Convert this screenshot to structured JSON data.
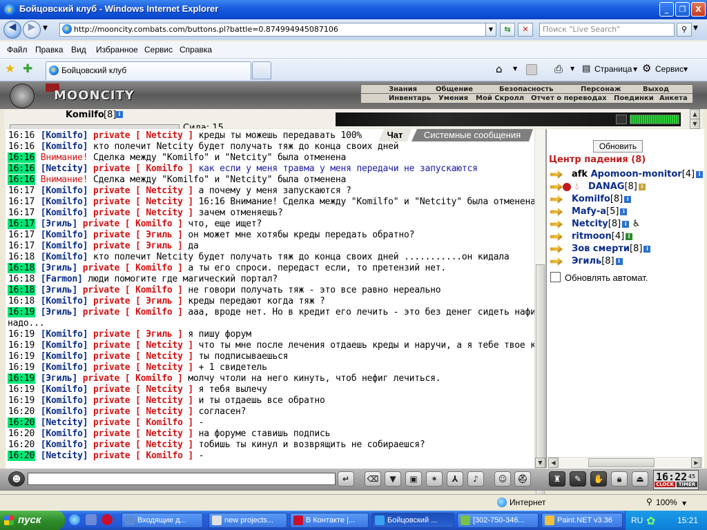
{
  "window": {
    "title": "Бойцовский клуб - Windows Internet Explorer",
    "min": "_",
    "max": "❐",
    "close": "X"
  },
  "address": {
    "url": "http://mooncity.combats.com/buttons.pl?battle=0.874994945087106",
    "search_placeholder": "Поиск \"Live Search\""
  },
  "menu": [
    "Файл",
    "Правка",
    "Вид",
    "Избранное",
    "Сервис",
    "Справка"
  ],
  "tab": {
    "label": "Бойцовский клуб"
  },
  "ie_toolbar": {
    "page": "Страница",
    "service": "Сервис"
  },
  "game": {
    "logo": "MOONCITY",
    "nav_top": [
      "Знания",
      "Общение",
      "Безопасность",
      "Персонаж",
      "Выход"
    ],
    "nav_bottom": [
      "Инвентарь",
      "Умения",
      "Мой Скролл",
      "Отчет о переводах",
      "Поединки",
      "Анкета"
    ],
    "player": {
      "name": "Komilfo",
      "level": "[8]",
      "stat": "Сила: 15"
    }
  },
  "chat": {
    "tabs": [
      "Чат",
      "Системные сообщения"
    ],
    "lines": [
      {
        "t": "16:16",
        "hl": false,
        "parts": [
          {
            "c": "nick",
            "s": "[Komilfo]"
          },
          {
            "c": "priv",
            "s": " private [ Netcity ]"
          },
          {
            "c": "",
            "s": " креды ты можешь передавать 100%"
          }
        ]
      },
      {
        "t": "16:16",
        "hl": false,
        "parts": [
          {
            "c": "nick",
            "s": "[Komilfo]"
          },
          {
            "c": "",
            "s": " кто полечит Netcity будет получать тяж до конца своих дней"
          }
        ]
      },
      {
        "t": "16:16",
        "hl": true,
        "parts": [
          {
            "c": "warn",
            "s": "Внимание!"
          },
          {
            "c": "",
            "s": " Сделка между \"Komilfo\" и \"Netcity\" была отменена"
          }
        ]
      },
      {
        "t": "16:16",
        "hl": true,
        "parts": [
          {
            "c": "nick",
            "s": "[Netcity]"
          },
          {
            "c": "priv",
            "s": " private [ Komilfo ]"
          },
          {
            "c": "blue",
            "s": " как если у меня травма у меня передачи не запускаются"
          }
        ]
      },
      {
        "t": "16:16",
        "hl": true,
        "parts": [
          {
            "c": "warn",
            "s": "Внимание!"
          },
          {
            "c": "",
            "s": " Сделка между \"Komilfo\" и \"Netcity\" была отменена"
          }
        ]
      },
      {
        "t": "16:17",
        "hl": false,
        "parts": [
          {
            "c": "nick",
            "s": "[Komilfo]"
          },
          {
            "c": "priv",
            "s": " private [ Netcity ]"
          },
          {
            "c": "",
            "s": " а почему у меня запускаются ?"
          }
        ]
      },
      {
        "t": "16:17",
        "hl": false,
        "parts": [
          {
            "c": "nick",
            "s": "[Komilfo]"
          },
          {
            "c": "priv",
            "s": " private [ Netcity ]"
          },
          {
            "c": "",
            "s": " 16:16 Внимание! Сделка между \"Komilfo\" и \"Netcity\" была отменена"
          }
        ]
      },
      {
        "t": "16:17",
        "hl": false,
        "parts": [
          {
            "c": "nick",
            "s": "[Komilfo]"
          },
          {
            "c": "priv",
            "s": " private [ Netcity ]"
          },
          {
            "c": "",
            "s": " зачем отменяешь?"
          }
        ]
      },
      {
        "t": "16:17",
        "hl": true,
        "parts": [
          {
            "c": "nick",
            "s": "[Эгиль]"
          },
          {
            "c": "priv",
            "s": " private [ Komilfo ]"
          },
          {
            "c": "",
            "s": " что, еще ищет?"
          }
        ]
      },
      {
        "t": "16:17",
        "hl": false,
        "parts": [
          {
            "c": "nick",
            "s": "[Komilfo]"
          },
          {
            "c": "priv",
            "s": " private [ Эгиль ]"
          },
          {
            "c": "",
            "s": " он может мне хотябы креды передать обратно?"
          }
        ]
      },
      {
        "t": "16:17",
        "hl": false,
        "parts": [
          {
            "c": "nick",
            "s": "[Komilfo]"
          },
          {
            "c": "priv",
            "s": " private [ Эгиль ]"
          },
          {
            "c": "",
            "s": " да"
          }
        ]
      },
      {
        "t": "16:18",
        "hl": false,
        "parts": [
          {
            "c": "nick",
            "s": "[Komilfo]"
          },
          {
            "c": "",
            "s": " кто полечит Netcity будет получать тяж до конца своих дней ...........он кидала"
          }
        ]
      },
      {
        "t": "16:18",
        "hl": true,
        "parts": [
          {
            "c": "nick",
            "s": "[Эгиль]"
          },
          {
            "c": "priv",
            "s": " private [ Komilfo ]"
          },
          {
            "c": "",
            "s": " а ты его спроси. передаст если, то претензий нет."
          }
        ]
      },
      {
        "t": "16:18",
        "hl": false,
        "parts": [
          {
            "c": "nick",
            "s": "[Farmon]"
          },
          {
            "c": "",
            "s": " люди помогите где магический портал?"
          }
        ]
      },
      {
        "t": "16:18",
        "hl": true,
        "parts": [
          {
            "c": "nick",
            "s": "[Эгиль]"
          },
          {
            "c": "priv",
            "s": " private [ Komilfo ]"
          },
          {
            "c": "",
            "s": " не говори получать тяж - это все равно нереально"
          }
        ]
      },
      {
        "t": "16:18",
        "hl": false,
        "parts": [
          {
            "c": "nick",
            "s": "[Komilfo]"
          },
          {
            "c": "priv",
            "s": " private [ Эгиль ]"
          },
          {
            "c": "",
            "s": " креды передают когда тяж ?"
          }
        ]
      },
      {
        "t": "16:19",
        "hl": true,
        "parts": [
          {
            "c": "nick",
            "s": "[Эгиль]"
          },
          {
            "c": "priv",
            "s": " private [ Komilfo ]"
          },
          {
            "c": "",
            "s": " ааа, вроде нет. Но в кредит его лечить - это без денег сидеть нафиг"
          }
        ]
      },
      {
        "t": "",
        "hl": false,
        "parts": [
          {
            "c": "",
            "s": "надо..."
          }
        ]
      },
      {
        "t": "16:19",
        "hl": false,
        "parts": [
          {
            "c": "nick",
            "s": "[Komilfo]"
          },
          {
            "c": "priv",
            "s": " private [ Эгиль ]"
          },
          {
            "c": "",
            "s": " я пишу форум"
          }
        ]
      },
      {
        "t": "16:19",
        "hl": false,
        "parts": [
          {
            "c": "nick",
            "s": "[Komilfo]"
          },
          {
            "c": "priv",
            "s": " private [ Netcity ]"
          },
          {
            "c": "",
            "s": " что ты мне после лечения отдаешь креды и наручи, а я тебе твое кольцо"
          }
        ]
      },
      {
        "t": "16:19",
        "hl": false,
        "parts": [
          {
            "c": "nick",
            "s": "[Komilfo]"
          },
          {
            "c": "priv",
            "s": " private [ Netcity ]"
          },
          {
            "c": "",
            "s": " ты подписываешься"
          }
        ]
      },
      {
        "t": "16:19",
        "hl": false,
        "parts": [
          {
            "c": "nick",
            "s": "[Komilfo]"
          },
          {
            "c": "priv",
            "s": " private [ Netcity ]"
          },
          {
            "c": "",
            "s": " + 1 свидетель"
          }
        ]
      },
      {
        "t": "16:19",
        "hl": true,
        "parts": [
          {
            "c": "nick",
            "s": "[Эгиль]"
          },
          {
            "c": "priv",
            "s": " private [ Komilfo ]"
          },
          {
            "c": "",
            "s": " молчу чтоли на него кинуть, чтоб нефиг лечиться."
          }
        ]
      },
      {
        "t": "16:19",
        "hl": false,
        "parts": [
          {
            "c": "nick",
            "s": "[Komilfo]"
          },
          {
            "c": "priv",
            "s": " private [ Netcity ]"
          },
          {
            "c": "",
            "s": " я тебя вылечу"
          }
        ]
      },
      {
        "t": "16:19",
        "hl": false,
        "parts": [
          {
            "c": "nick",
            "s": "[Komilfo]"
          },
          {
            "c": "priv",
            "s": " private [ Netcity ]"
          },
          {
            "c": "",
            "s": " и ты отдаешь все обратно"
          }
        ]
      },
      {
        "t": "16:20",
        "hl": false,
        "parts": [
          {
            "c": "nick",
            "s": "[Komilfo]"
          },
          {
            "c": "priv",
            "s": " private [ Netcity ]"
          },
          {
            "c": "",
            "s": " согласен?"
          }
        ]
      },
      {
        "t": "16:20",
        "hl": true,
        "parts": [
          {
            "c": "nick",
            "s": "[Netcity]"
          },
          {
            "c": "priv",
            "s": " private [ Komilfo ]"
          },
          {
            "c": "",
            "s": " -"
          }
        ]
      },
      {
        "t": "16:20",
        "hl": false,
        "parts": [
          {
            "c": "nick",
            "s": "[Komilfo]"
          },
          {
            "c": "priv",
            "s": " private [ Netcity ]"
          },
          {
            "c": "",
            "s": " на форуме ставишь подпись"
          }
        ]
      },
      {
        "t": "16:20",
        "hl": false,
        "parts": [
          {
            "c": "nick",
            "s": "[Komilfo]"
          },
          {
            "c": "priv",
            "s": " private [ Netcity ]"
          },
          {
            "c": "",
            "s": " тобишь ты кинул и возврящить не собираешся?"
          }
        ]
      },
      {
        "t": "16:20",
        "hl": true,
        "parts": [
          {
            "c": "nick",
            "s": "[Netcity]"
          },
          {
            "c": "priv",
            "s": " private [ Komilfo ]"
          },
          {
            "c": "",
            "s": " -"
          }
        ]
      }
    ]
  },
  "room": {
    "refresh": "Обновить",
    "title": "Центр падения (8)",
    "users": [
      {
        "name": "Apomoon-monitor",
        "level": "[4]",
        "prefix": "afk "
      },
      {
        "name": "DANAG",
        "level": "[8]",
        "prefix": ""
      },
      {
        "name": "Komilfo",
        "level": "[8]",
        "prefix": ""
      },
      {
        "name": "Mafy-a",
        "level": "[5]",
        "prefix": ""
      },
      {
        "name": "Netcity",
        "level": "[8]",
        "prefix": ""
      },
      {
        "name": "ritmoon",
        "level": "[4]",
        "prefix": ""
      },
      {
        "name": "Зов смерти",
        "level": "[8]",
        "prefix": ""
      },
      {
        "name": "Эгиль",
        "level": "[8]",
        "prefix": ""
      }
    ],
    "auto_refresh": "Обновлять автомат."
  },
  "clock": {
    "time": "16:22",
    "sec": "45",
    "l1": "CLOCK",
    "l2": "TIMER"
  },
  "status": {
    "zone": "Интернет",
    "zoom": "100%"
  },
  "taskbar": {
    "start": "пуск",
    "tasks": [
      "Входящие д...",
      "new projects...",
      "В Контакте |...",
      "Бойцовский ...",
      "[302-750-346...",
      "Paint.NET v3.36"
    ],
    "lang": "RU",
    "time": "15:21"
  },
  "colors": {
    "highlight": "#00e676",
    "nick": "#0a2c8a",
    "private": "#d41212"
  }
}
